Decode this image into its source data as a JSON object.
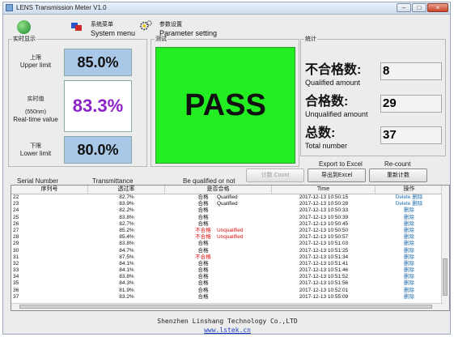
{
  "window": {
    "title": "LENS Transmission Meter V1.0",
    "controls": {
      "minimize": "–",
      "maximize": "□",
      "close": "×"
    }
  },
  "toolbar": {
    "system_menu_cn": "系统菜单",
    "system_menu_en": "System menu",
    "parameter_cn": "参数设置",
    "parameter_en": "Parameter setting"
  },
  "realtime": {
    "group_label": "实时显示",
    "upper_cn": "上限",
    "upper_en": "Upper limit",
    "upper_value": "85.0%",
    "real_cn": "实时值",
    "real_nm": "(550nm)",
    "real_en": "Real-time value",
    "real_value": "83.3%",
    "lower_cn": "下限",
    "lower_en": "Lower limit",
    "lower_value": "80.0%"
  },
  "test": {
    "group_label": "测试",
    "result": "PASS",
    "result_color": "#22ee22"
  },
  "stats": {
    "group_label": "统计",
    "unqual_cn": "不合格数:",
    "unqual_en": "Qualified amount",
    "unqual_value": "8",
    "qual_cn": "合格数:",
    "qual_en": "Unqualified amount",
    "qual_value": "29",
    "total_cn": "总数:",
    "total_en": "Total number",
    "total_value": "37"
  },
  "actions": {
    "count_btn": "计数 Count",
    "export_en": "Export to Excel",
    "export_btn": "导出到Excel",
    "recount_en": "Re-count",
    "recount_btn": "重新计数"
  },
  "table_labels": {
    "serial_en": "Serial Number",
    "trans_en": "Transmittance",
    "qualified_en": "Be qualified or not"
  },
  "table": {
    "headers": [
      "序列号",
      "透过率",
      "是否合格",
      "Time",
      "操作"
    ],
    "rows": [
      {
        "sn": "22",
        "trans": "82.7%",
        "status": "合格",
        "note": "Qualified",
        "time": "2017-12-13 10:50:15",
        "action": "Delete 删除"
      },
      {
        "sn": "23",
        "trans": "83.9%",
        "status": "合格",
        "note": "Qualified",
        "time": "2017-12-13 10:50:28",
        "action": "Delete 删除"
      },
      {
        "sn": "24",
        "trans": "82.2%",
        "status": "合格",
        "note": "",
        "time": "2017-12-13 10:50:33",
        "action": "删除"
      },
      {
        "sn": "25",
        "trans": "83.8%",
        "status": "合格",
        "note": "",
        "time": "2017-12-13 10:50:39",
        "action": "删除"
      },
      {
        "sn": "26",
        "trans": "82.7%",
        "status": "合格",
        "note": "",
        "time": "2017-12-13 10:50:45",
        "action": "删除"
      },
      {
        "sn": "27",
        "trans": "85.2%",
        "status": "不合格",
        "note": "Unqualified",
        "time": "2017-12-13 10:50:50",
        "action": "删除"
      },
      {
        "sn": "28",
        "trans": "85.4%",
        "status": "不合格",
        "note": "Unqualified",
        "time": "2017-12-13 10:50:57",
        "action": "删除"
      },
      {
        "sn": "29",
        "trans": "83.8%",
        "status": "合格",
        "note": "",
        "time": "2017-12-13 10:51:03",
        "action": "删除"
      },
      {
        "sn": "30",
        "trans": "84.7%",
        "status": "合格",
        "note": "",
        "time": "2017-12-13 10:51:25",
        "action": "删除"
      },
      {
        "sn": "31",
        "trans": "87.5%",
        "status": "不合格",
        "note": "",
        "time": "2017-12-13 10:51:34",
        "action": "删除"
      },
      {
        "sn": "32",
        "trans": "84.1%",
        "status": "合格",
        "note": "",
        "time": "2017-12-13 10:51:41",
        "action": "删除"
      },
      {
        "sn": "33",
        "trans": "84.1%",
        "status": "合格",
        "note": "",
        "time": "2017-12-13 10:51:46",
        "action": "删除"
      },
      {
        "sn": "34",
        "trans": "83.8%",
        "status": "合格",
        "note": "",
        "time": "2017-12-13 10:51:52",
        "action": "删除"
      },
      {
        "sn": "35",
        "trans": "84.3%",
        "status": "合格",
        "note": "",
        "time": "2017-12-13 10:51:56",
        "action": "删除"
      },
      {
        "sn": "36",
        "trans": "81.9%",
        "status": "合格",
        "note": "",
        "time": "2017-12-13 10:52:01",
        "action": "删除"
      },
      {
        "sn": "37",
        "trans": "83.2%",
        "status": "合格",
        "note": "",
        "time": "2017-12-13 10:55:09",
        "action": "删除"
      }
    ]
  },
  "footer": {
    "company": "Shenzhen Linshang Technology Co.,LTD",
    "url": "www.lstek.cn"
  }
}
